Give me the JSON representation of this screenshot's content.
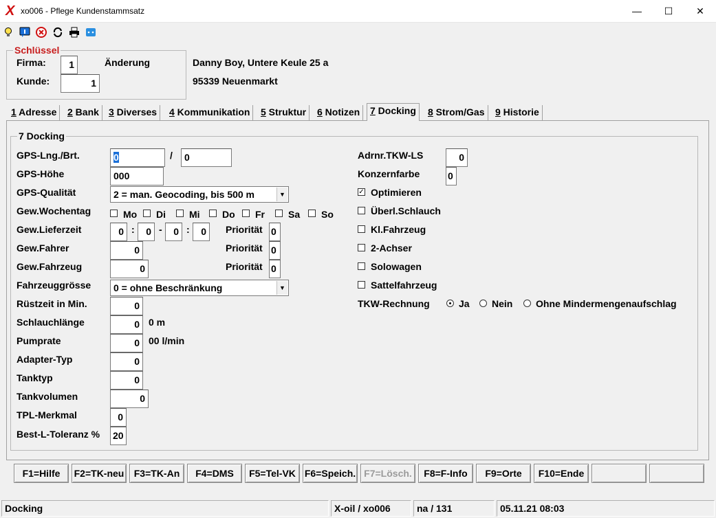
{
  "window": {
    "title": "xo006 - Pflege Kundenstammsatz",
    "app_mark": "X",
    "minimize": "—",
    "maximize": "☐",
    "close": "✕"
  },
  "toolbar": {
    "icons": [
      "lightbulb-icon",
      "info-icon",
      "cancel-icon",
      "refresh-icon",
      "print-icon",
      "chat-icon"
    ]
  },
  "key": {
    "title": "Schlüssel",
    "firma_label": "Firma:",
    "firma_value": "1",
    "kunde_label": "Kunde:",
    "kunde_value": "1",
    "mode": "Änderung"
  },
  "customer": {
    "line1": "Danny Boy, Untere Keule 25 a",
    "line2": "95339 Neuenmarkt"
  },
  "tabs": [
    {
      "key": "1",
      "label": " Adresse"
    },
    {
      "key": "2",
      "label": " Bank"
    },
    {
      "key": "3",
      "label": " Diverses"
    },
    {
      "key": "4",
      "label": " Kommunikation"
    },
    {
      "key": "5",
      "label": " Struktur"
    },
    {
      "key": "6",
      "label": " Notizen"
    },
    {
      "key": "7",
      "label": " Docking"
    },
    {
      "key": "8",
      "label": " Strom/Gas"
    },
    {
      "key": "9",
      "label": " Historie"
    }
  ],
  "docking": {
    "title": "7 Docking",
    "gps_lng_label": "GPS-Lng./Brt.",
    "gps_lng": "0",
    "gps_sep": "/",
    "gps_brt": "0",
    "gps_hoehe_label": "GPS-Höhe",
    "gps_hoehe": "000",
    "gps_qualitaet_label": "GPS-Qualität",
    "gps_qualitaet": "2 = man. Geocoding, bis 500 m",
    "wochentag_label": "Gew.Wochentag",
    "weekdays": [
      "Mo",
      "Di",
      "Mi",
      "Do",
      "Fr",
      "Sa",
      "So"
    ],
    "lieferzeit_label": "Gew.Lieferzeit",
    "lieferzeit": [
      "0",
      "0",
      "0",
      "0"
    ],
    "colon": ":",
    "dash": "-",
    "prioritaet_label": "Priorität",
    "prio_lieferzeit": "0",
    "fahrer_label": "Gew.Fahrer",
    "fahrer": "0",
    "prio_fahrer": "0",
    "fahrzeug_label": "Gew.Fahrzeug",
    "fahrzeug": "0",
    "prio_fahrzeug": "0",
    "fahrzeuggroesse_label": "Fahrzeuggrösse",
    "fahrzeuggroesse": "0 = ohne Beschränkung",
    "ruestzeit_label": "Rüstzeit in Min.",
    "ruestzeit": "0",
    "schlauch_label": "Schlauchlänge",
    "schlauch": "0",
    "schlauch_unit": "0 m",
    "pumprate_label": "Pumprate",
    "pumprate": "0",
    "pumprate_unit": "00 l/min",
    "adapter_label": "Adapter-Typ",
    "adapter": "0",
    "tanktyp_label": "Tanktyp",
    "tanktyp": "0",
    "tankvolumen_label": "Tankvolumen",
    "tankvolumen": "0",
    "tpl_label": "TPL-Merkmal",
    "tpl": "0",
    "toleranz_label": "Best-L-Toleranz %",
    "toleranz": "20",
    "adrnr_label": "Adrnr.TKW-LS",
    "adrnr": "0",
    "konzernfarbe_label": "Konzernfarbe",
    "konzernfarbe": "0",
    "options": [
      {
        "label": "Optimieren",
        "checked": true
      },
      {
        "label": "Überl.Schlauch",
        "checked": false
      },
      {
        "label": "Kl.Fahrzeug",
        "checked": false
      },
      {
        "label": "2-Achser",
        "checked": false
      },
      {
        "label": "Solowagen",
        "checked": false
      },
      {
        "label": "Sattelfahrzeug",
        "checked": false
      }
    ],
    "tkw_label": "TKW-Rechnung",
    "tkw_options": [
      "Ja",
      "Nein",
      "Ohne Mindermengenaufschlag"
    ],
    "tkw_selected": "Ja"
  },
  "fkeys": [
    "F1=Hilfe",
    "F2=TK-neu",
    "F3=TK-An",
    "F4=DMS",
    "F5=Tel-VK",
    "F6=Speich.",
    "F7=Lösch.",
    "F8=F-Info",
    "F9=Orte",
    "F10=Ende",
    "",
    ""
  ],
  "status": {
    "mode": "Docking",
    "app": "X-oil / xo006",
    "user": "na / 131",
    "datetime": "05.11.21 08:03"
  }
}
